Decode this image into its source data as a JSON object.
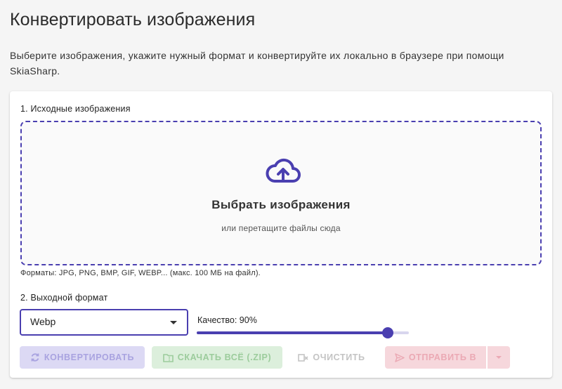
{
  "page": {
    "title": "Конвертировать изображения",
    "description": "Выберите изображения, укажите нужный формат и конвертируйте их локально в браузере при помощи SkiaSharp."
  },
  "source": {
    "label": "1. Исходные изображения",
    "dropzone_title": "Выбрать изображения",
    "dropzone_subtitle": "или перетащите файлы сюда",
    "formats_note": "Форматы: JPG, PNG, BMP, GIF, WEBP... (макс. 100 МБ на файл)."
  },
  "output": {
    "label": "2. Выходной формат",
    "format_value": "Webp",
    "quality_label": "Качество: 90%",
    "quality_value": 90
  },
  "actions": {
    "convert": "КОНВЕРТИРОВАТЬ",
    "download_all": "СКАЧАТЬ ВСЁ (.ZIP)",
    "clear": "ОЧИСТИТЬ",
    "send_to": "ОТПРАВИТЬ В"
  },
  "colors": {
    "accent": "#4a3fb0",
    "convert_disabled_bg": "#dcd9f4",
    "download_disabled_bg": "#dcefdc",
    "send_disabled_bg": "#f6d7dc"
  },
  "icons": {
    "dropzone": "cloud-upload-icon",
    "convert": "refresh-icon",
    "download": "folder-zip-icon",
    "clear": "clear-icon",
    "send": "send-icon"
  }
}
